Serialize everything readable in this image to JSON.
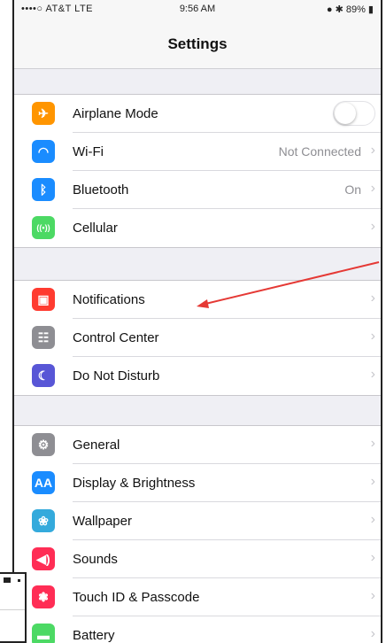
{
  "status_bar": {
    "carrier": "••••○ AT&T  LTE",
    "time": "9:56 AM",
    "battery": "● ✱ 89% ▮"
  },
  "nav": {
    "title": "Settings"
  },
  "colors": {
    "airplane": "#ff9500",
    "wifi": "#1a8cff",
    "bluetooth": "#1a8cff",
    "cellular": "#4cd964",
    "notifications": "#ff3b30",
    "control_center": "#8e8e93",
    "dnd": "#5856d6",
    "general": "#8e8e93",
    "display": "#1a8cff",
    "wallpaper": "#34aadc",
    "sounds": "#ff2d55",
    "touch_id": "#ff2d55",
    "battery": "#4cd964",
    "annotation_arrow": "#e53935"
  },
  "sections": [
    {
      "rows": [
        {
          "icon": "airplane-icon",
          "glyph": "✈",
          "label": "Airplane Mode",
          "control": "toggle",
          "toggle_on": false
        },
        {
          "icon": "wifi-icon",
          "glyph": "◠",
          "label": "Wi-Fi",
          "detail": "Not Connected"
        },
        {
          "icon": "bluetooth-icon",
          "glyph": "ᛒ",
          "label": "Bluetooth",
          "detail": "On"
        },
        {
          "icon": "cellular-icon",
          "glyph": "((•))",
          "label": "Cellular"
        }
      ]
    },
    {
      "rows": [
        {
          "icon": "notifications-icon",
          "glyph": "▣",
          "label": "Notifications"
        },
        {
          "icon": "control-center-icon",
          "glyph": "☷",
          "label": "Control Center"
        },
        {
          "icon": "do-not-disturb-icon",
          "glyph": "☾",
          "label": "Do Not Disturb"
        }
      ]
    },
    {
      "rows": [
        {
          "icon": "gear-icon",
          "glyph": "⚙",
          "label": "General"
        },
        {
          "icon": "display-brightness-icon",
          "glyph": "AA",
          "label": "Display & Brightness"
        },
        {
          "icon": "wallpaper-icon",
          "glyph": "❀",
          "label": "Wallpaper"
        },
        {
          "icon": "sounds-icon",
          "glyph": "◀)",
          "label": "Sounds"
        },
        {
          "icon": "touch-id-icon",
          "glyph": "❃",
          "label": "Touch ID & Passcode"
        },
        {
          "icon": "battery-icon",
          "glyph": "▬",
          "label": "Battery"
        }
      ]
    }
  ]
}
